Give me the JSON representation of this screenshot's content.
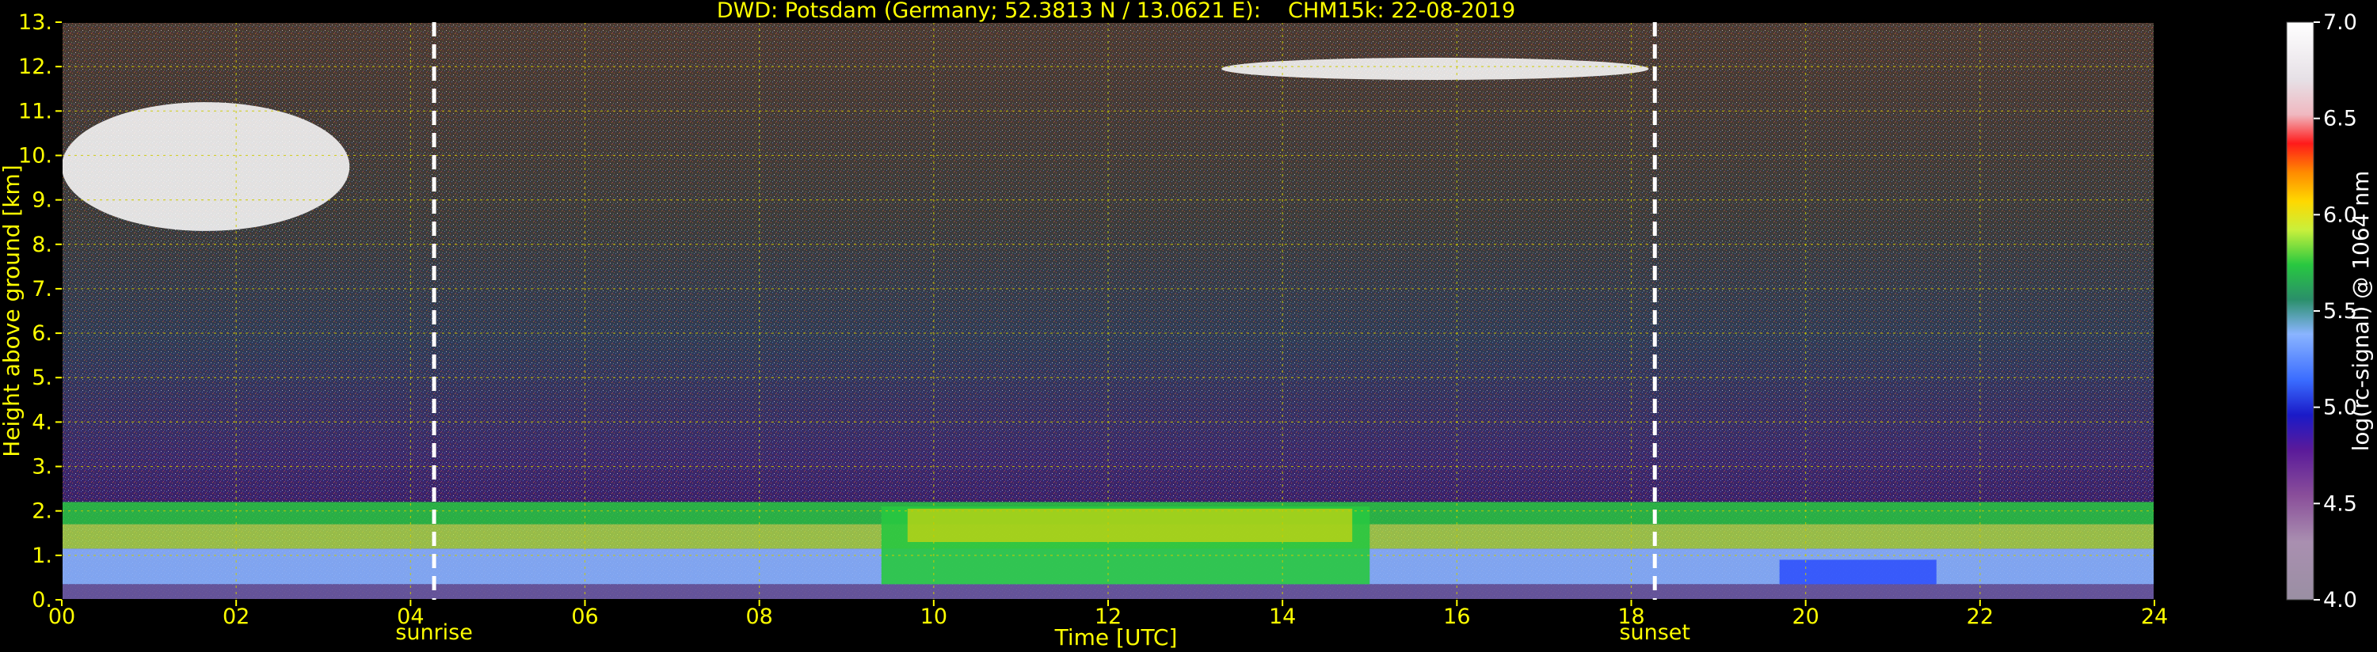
{
  "chart_data": {
    "type": "heatmap",
    "title": "DWD: Potsdam (Germany; 52.3813 N / 13.0621 E):    CHM15k: 22-08-2019",
    "xlabel": "Time [UTC]",
    "ylabel": "Height above ground [km]",
    "x_ticks": [
      "00",
      "02",
      "04",
      "06",
      "08",
      "10",
      "12",
      "14",
      "16",
      "18",
      "20",
      "22",
      "24"
    ],
    "y_ticks": [
      "0.",
      "1.",
      "2.",
      "3.",
      "4.",
      "5.",
      "6.",
      "7.",
      "8.",
      "9.",
      "10.",
      "11.",
      "12.",
      "13."
    ],
    "xlim": [
      0,
      24
    ],
    "ylim": [
      0,
      13
    ],
    "grid": true,
    "colorbar": {
      "label": "log(rc-signal) @ 1064 nm",
      "ticks": [
        "4.0",
        "4.5",
        "5.0",
        "5.5",
        "6.0",
        "6.5",
        "7.0"
      ],
      "range": [
        4.0,
        7.0
      ]
    },
    "markers": [
      {
        "label": "sunrise",
        "time": 4.27
      },
      {
        "label": "sunset",
        "time": 18.27
      }
    ],
    "features": [
      {
        "name": "boundary layer top",
        "time": [
          0,
          24
        ],
        "height_km": [
          1.8,
          2.2
        ]
      },
      {
        "name": "cirrus cloud",
        "time": [
          0.0,
          3.3
        ],
        "height_km": [
          8.3,
          11.2
        ]
      },
      {
        "name": "cirrus cloud",
        "time": [
          13.3,
          18.2
        ],
        "height_km": [
          11.7,
          12.2
        ]
      }
    ]
  },
  "colors": {
    "background": "#000000",
    "text": "#ffff00",
    "grid": "#cccc00",
    "marker": "#ffffff"
  }
}
